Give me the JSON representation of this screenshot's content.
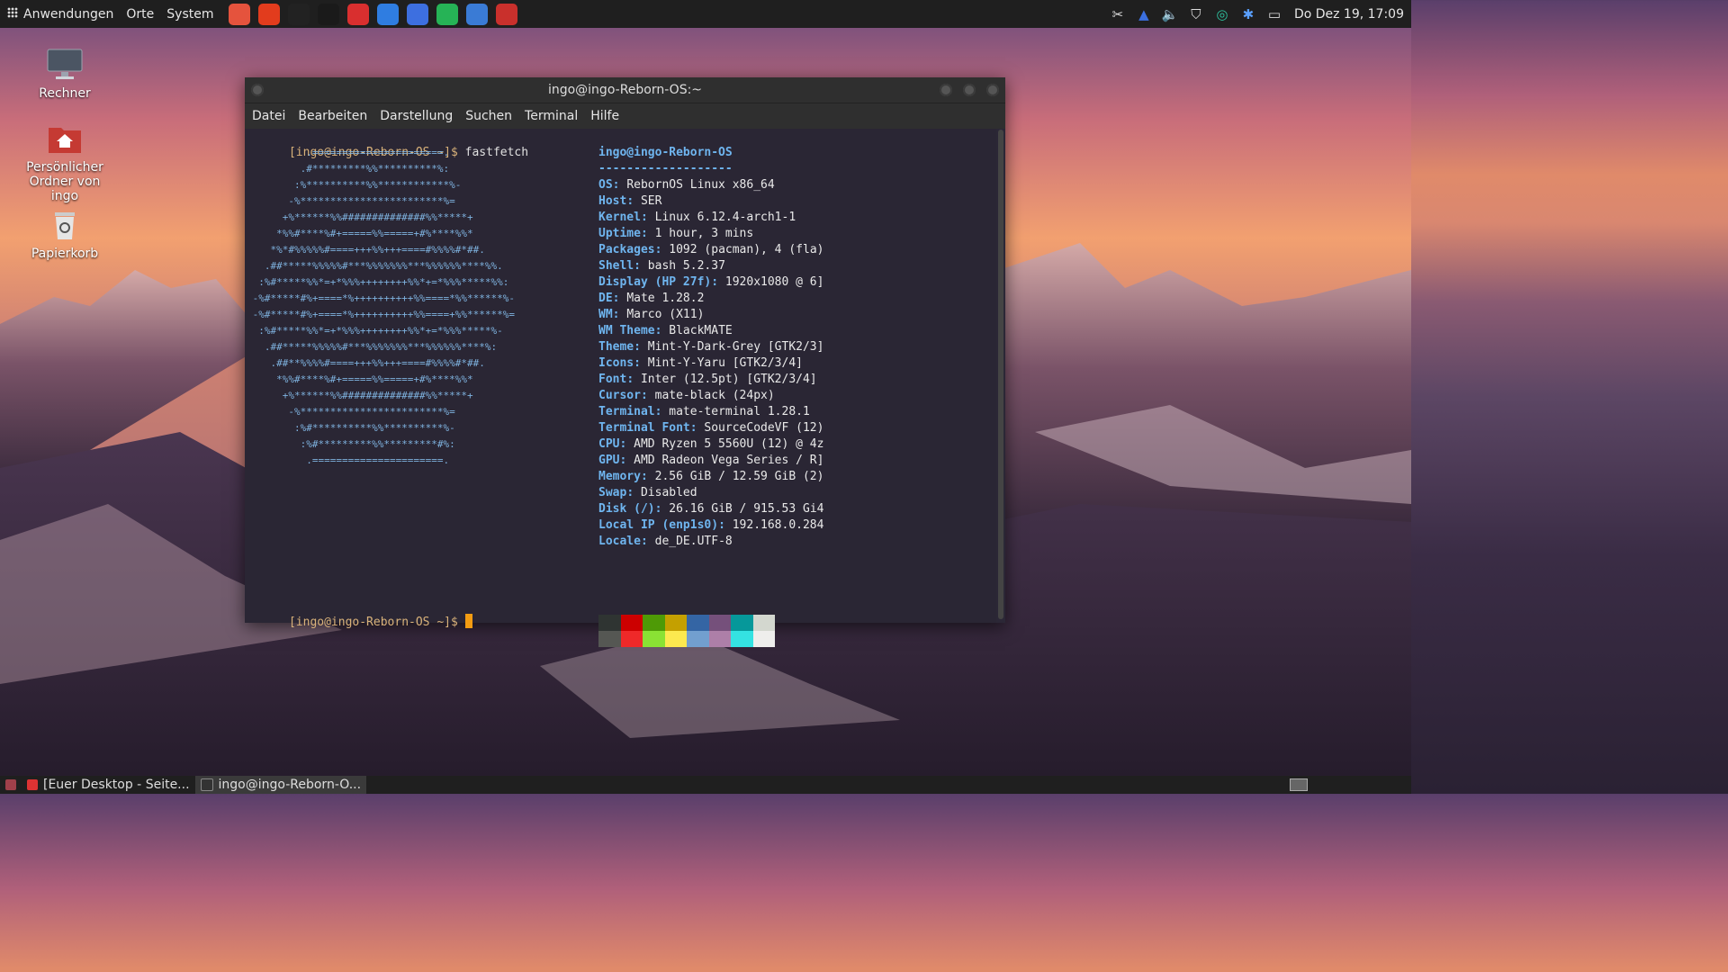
{
  "top_panel": {
    "menus": [
      "Anwendungen",
      "Orte",
      "System"
    ],
    "launchers": [
      {
        "icon": "browser-red-icon",
        "color": "#e5533d"
      },
      {
        "icon": "firefox-icon",
        "color": "#e23c1d"
      },
      {
        "icon": "terminal-icon",
        "color": "#222222"
      },
      {
        "icon": "writer-icon",
        "color": "#1a1a1a"
      },
      {
        "icon": "pdf-icon",
        "color": "#d92f2f"
      },
      {
        "icon": "download-icon",
        "color": "#2f7de1"
      },
      {
        "icon": "messenger-icon",
        "color": "#3d6fe0"
      },
      {
        "icon": "whatsapp-icon",
        "color": "#26b356"
      },
      {
        "icon": "screenshot-icon",
        "color": "#3a7bd5"
      },
      {
        "icon": "files-icon",
        "color": "#c9302c"
      }
    ],
    "tray_icons": [
      "scissors-icon",
      "network-icon",
      "volume-icon",
      "shield-icon",
      "vpn-icon",
      "bluetooth-icon",
      "display-icon"
    ],
    "clock": "Do Dez 19, 17:09"
  },
  "desktop": {
    "icons": [
      {
        "name": "computer-desktop-icon",
        "label": "Rechner"
      },
      {
        "name": "home-folder-desktop-icon",
        "label": "Persönlicher Ordner von ingo"
      },
      {
        "name": "trash-desktop-icon",
        "label": "Papierkorb"
      }
    ]
  },
  "terminal": {
    "title": "ingo@ingo-Reborn-OS:~",
    "menu": [
      "Datei",
      "Bearbeiten",
      "Darstellung",
      "Suchen",
      "Terminal",
      "Hilfe"
    ],
    "prompt": "[ingo@ingo-Reborn-OS ~]$",
    "command": "fastfetch",
    "user_host": "ingo@ingo-Reborn-OS",
    "separator": "-------------------",
    "info": [
      {
        "k": "OS",
        "v": "RebornOS Linux x86_64"
      },
      {
        "k": "Host",
        "v": "SER"
      },
      {
        "k": "Kernel",
        "v": "Linux 6.12.4-arch1-1"
      },
      {
        "k": "Uptime",
        "v": "1 hour, 3 mins"
      },
      {
        "k": "Packages",
        "v": "1092 (pacman), 4 (fla)"
      },
      {
        "k": "Shell",
        "v": "bash 5.2.37"
      },
      {
        "k": "Display (HP 27f)",
        "v": "1920x1080 @ 6]"
      },
      {
        "k": "DE",
        "v": "Mate 1.28.2"
      },
      {
        "k": "WM",
        "v": "Marco (X11)"
      },
      {
        "k": "WM Theme",
        "v": "BlackMATE"
      },
      {
        "k": "Theme",
        "v": "Mint-Y-Dark-Grey [GTK2/3]"
      },
      {
        "k": "Icons",
        "v": "Mint-Y-Yaru [GTK2/3/4]"
      },
      {
        "k": "Font",
        "v": "Inter (12.5pt) [GTK2/3/4]"
      },
      {
        "k": "Cursor",
        "v": "mate-black (24px)"
      },
      {
        "k": "Terminal",
        "v": "mate-terminal 1.28.1"
      },
      {
        "k": "Terminal Font",
        "v": "SourceCodeVF (12)"
      },
      {
        "k": "CPU",
        "v": "AMD Ryzen 5 5560U (12) @ 4z"
      },
      {
        "k": "GPU",
        "v": "AMD Radeon Vega Series / R]"
      },
      {
        "k": "Memory",
        "v": "2.56 GiB / 12.59 GiB (2)"
      },
      {
        "k": "Swap",
        "v": "Disabled"
      },
      {
        "k": "Disk (/)",
        "v": "26.16 GiB / 915.53 Gi4"
      },
      {
        "k": "Local IP (enp1s0)",
        "v": "192.168.0.284"
      },
      {
        "k": "Locale",
        "v": "de_DE.UTF-8"
      }
    ],
    "ascii_art": [
      "          .======================.",
      "         .#*********%%**********%:",
      "        :%**********%%************%-",
      "       -%************************%=",
      "      +%******%%##############%%*****+",
      "     *%%#****%#+=====%%=====+#%****%%*",
      "    *%*#%%%%%#====+++%%+++====#%%%%#*##.",
      "   .##*****%%%%%#***%%%%%%%***%%%%%%****%%.",
      "  :%#*****%%*=+*%%%++++++++%%*+=*%%%*****%%:",
      " -%#*****#%+====*%++++++++++%%====*%%******%-",
      " -%#*****#%+====*%++++++++++%%====+%%******%=",
      "  :%#*****%%*=+*%%%++++++++%%*+=*%%%*****%-",
      "   .##*****%%%%%#***%%%%%%%***%%%%%%****%:",
      "    .##**%%%%#====+++%%+++====#%%%%#*##.",
      "     *%%#****%#+=====%%=====+#%****%%*",
      "      +%******%%##############%%*****+",
      "       -%************************%=",
      "        :%#**********%%**********%-",
      "         :%#*********%%*********#%:",
      "          .======================."
    ],
    "palette_top": [
      "#2f3432",
      "#cc0000",
      "#4e9a06",
      "#c4a000",
      "#3465a4",
      "#75507b",
      "#06989a",
      "#d3d7cf"
    ],
    "palette_bottom": [
      "#555753",
      "#ef2929",
      "#8ae234",
      "#fce94f",
      "#729fcf",
      "#ad7fa8",
      "#34e2e2",
      "#eeeeec"
    ]
  },
  "bottom_panel": {
    "tasks": [
      {
        "label": "[Euer Desktop - Seite...",
        "icon": "browser-task-icon",
        "active": false
      },
      {
        "label": "ingo@ingo-Reborn-O...",
        "icon": "terminal-task-icon",
        "active": true
      }
    ]
  }
}
